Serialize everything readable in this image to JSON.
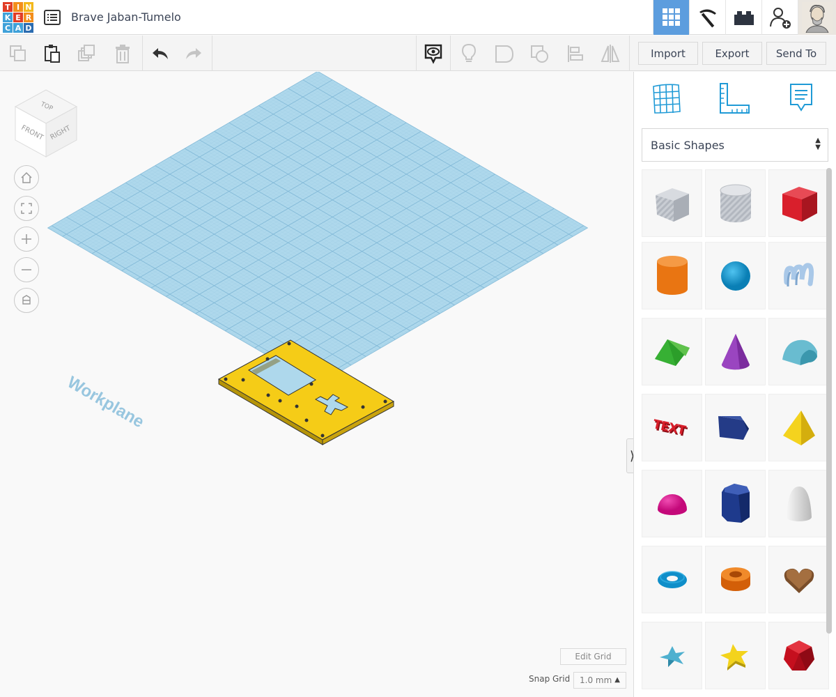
{
  "app": {
    "design_name": "Brave Jaban-Tumelo",
    "logo_letters": [
      "T",
      "I",
      "N",
      "K",
      "E",
      "R",
      "C",
      "A",
      "D"
    ],
    "logo_colors": [
      "#e13d26",
      "#f38e1b",
      "#f3b81b",
      "#3fa1d9",
      "#e13d26",
      "#f38e1b",
      "#3fa1d9",
      "#3fa1d9",
      "#2b6cb0"
    ]
  },
  "header": {
    "modes": [
      {
        "icon": "3d-grid-icon",
        "active": true
      },
      {
        "icon": "pickaxe-icon",
        "active": false
      },
      {
        "icon": "brick-icon",
        "active": false
      },
      {
        "icon": "add-user-icon",
        "active": false
      },
      {
        "icon": "user-avatar-icon",
        "active": false
      }
    ]
  },
  "toolbar": {
    "import_label": "Import",
    "export_label": "Export",
    "send_to_label": "Send To"
  },
  "viewcube": {
    "top": "TOP",
    "front": "FRONT",
    "right": "RIGHT"
  },
  "workplane": {
    "label": "Workplane"
  },
  "grid": {
    "edit_label": "Edit Grid",
    "snap_label": "Snap Grid",
    "snap_value": "1.0 mm"
  },
  "panel": {
    "category": "Basic Shapes",
    "shapes": [
      "box-hole",
      "cylinder-hole",
      "box",
      "cylinder",
      "sphere",
      "scribble",
      "roof",
      "cone",
      "round-roof",
      "text",
      "polygon-shape",
      "pyramid",
      "half-sphere",
      "polygon",
      "paraboloid",
      "torus",
      "tube",
      "heart",
      "star",
      "star-yellow",
      "icosahedron"
    ]
  }
}
